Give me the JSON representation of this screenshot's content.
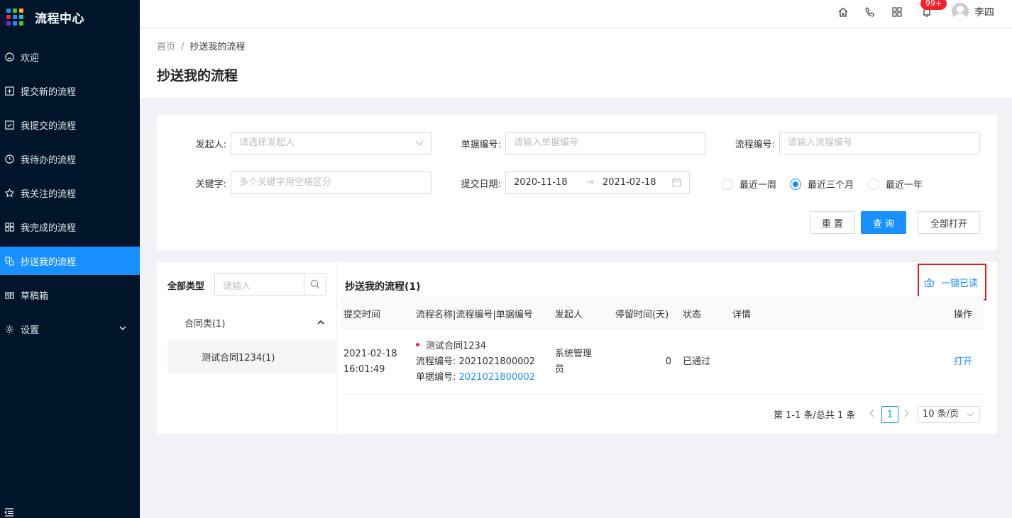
{
  "app": {
    "title": "流程中心"
  },
  "sidebar": {
    "items": [
      {
        "label": "欢迎",
        "icon": "smile-icon"
      },
      {
        "label": "提交新的流程",
        "icon": "plus-square-icon"
      },
      {
        "label": "我提交的流程",
        "icon": "check-square-icon"
      },
      {
        "label": "我待办的流程",
        "icon": "clock-icon"
      },
      {
        "label": "我关注的流程",
        "icon": "star-icon"
      },
      {
        "label": "我完成的流程",
        "icon": "appstore-icon"
      },
      {
        "label": "抄送我的流程",
        "icon": "copy-icon",
        "active": true
      },
      {
        "label": "草稿箱",
        "icon": "read-icon"
      },
      {
        "label": "设置",
        "icon": "setting-icon"
      }
    ]
  },
  "header": {
    "notification_badge": "99+",
    "username": "李四"
  },
  "breadcrumb": {
    "home": "首页",
    "separator": "/",
    "current": "抄送我的流程"
  },
  "page": {
    "title": "抄送我的流程"
  },
  "filters": {
    "initiator": {
      "label": "发起人:",
      "placeholder": "请选择发起人"
    },
    "doc_no": {
      "label": "单据编号:",
      "placeholder": "请输入单据编号"
    },
    "flow_no": {
      "label": "流程编号:",
      "placeholder": "请输入流程编号"
    },
    "keyword": {
      "label": "关键字:",
      "placeholder": "多个关键字用空格区分"
    },
    "date": {
      "label": "提交日期:",
      "start": "2020-11-18",
      "arrow": "→",
      "end": "2021-02-18"
    },
    "ranges": [
      {
        "label": "最近一周",
        "checked": false
      },
      {
        "label": "最近三个月",
        "checked": true
      },
      {
        "label": "最近一年",
        "checked": false
      }
    ],
    "buttons": {
      "reset": "重 置",
      "query": "查 询",
      "open_all": "全部打开"
    }
  },
  "tree": {
    "header": "全部类型",
    "search_placeholder": "请输入",
    "group": "合同类(1)",
    "child": "测试合同1234(1)"
  },
  "list": {
    "title": "抄送我的流程(1)",
    "read_all": "一键已读",
    "columns": [
      "提交时间",
      "流程名称|流程编号|单据编号",
      "发起人",
      "停留时间(天)",
      "状态",
      "详情",
      "操作"
    ],
    "rows": [
      {
        "date": "2021-02-18",
        "time": "16:01:49",
        "name": "测试合同1234",
        "flow_no_label": "流程编号: ",
        "flow_no": "2021021800002",
        "doc_no_label": "单据编号: ",
        "doc_no": "2021021800002",
        "initiator_line1": "系统管理",
        "initiator_line2": "员",
        "stay_days": "0",
        "status": "已通过",
        "detail": "",
        "action": "打开"
      }
    ]
  },
  "pagination": {
    "total_text": "第 1-1 条/总共 1 条",
    "current": "1",
    "page_size": "10 条/页"
  },
  "colors": {
    "sidebar_bg": "#001529",
    "accent": "#1890ff",
    "highlight_border": "#e8191c",
    "badge": "#f5222d"
  }
}
